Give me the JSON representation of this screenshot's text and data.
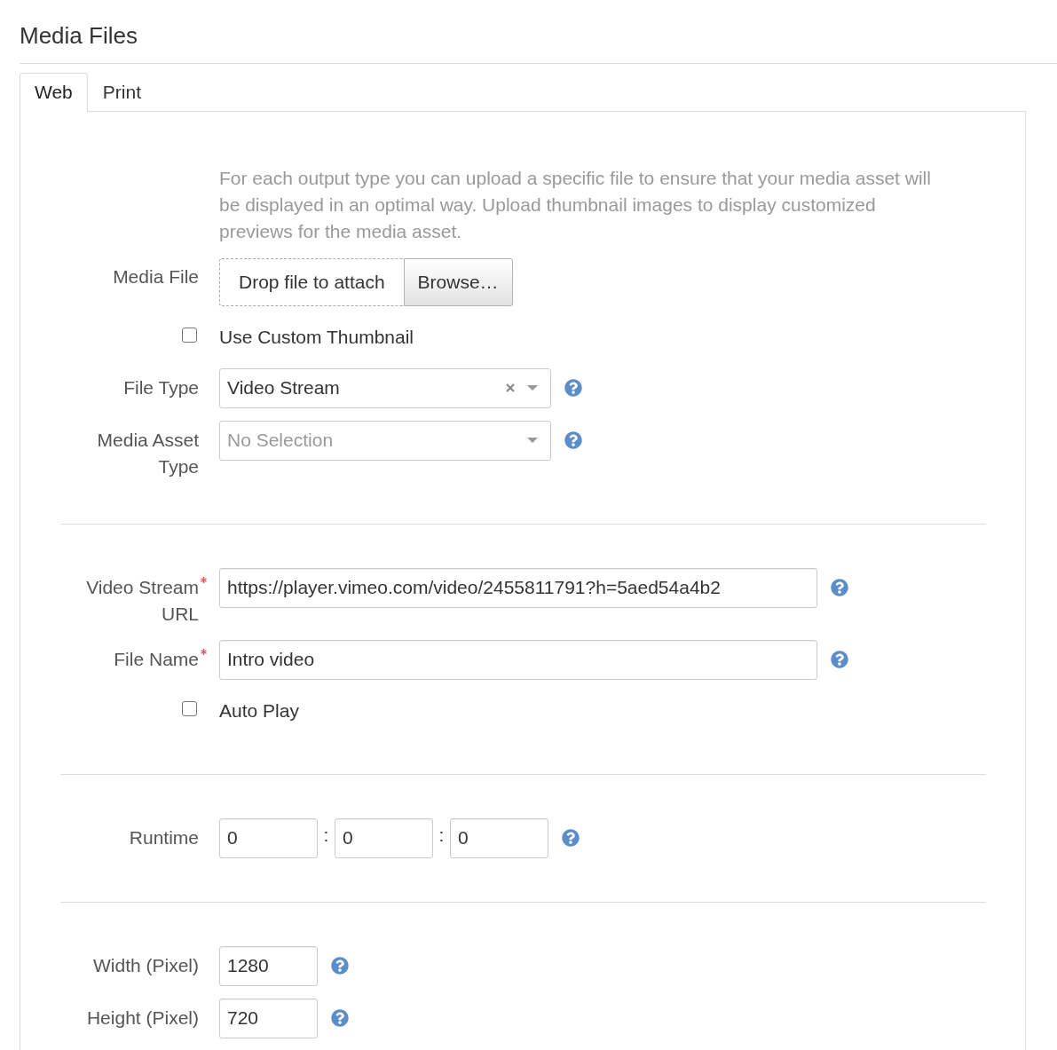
{
  "title": "Media Files",
  "tabs": [
    {
      "label": "Web",
      "selected": true
    },
    {
      "label": "Print",
      "selected": false
    }
  ],
  "description": "For each output type you can upload a specific file to ensure that your media asset will be displayed in an optimal way. Upload thumbnail images to display customized previews for the media asset.",
  "sections": [
    {
      "fields": [
        {
          "kind": "file",
          "label": "Media File",
          "drop_text": "Drop file to attach",
          "button": "Browse…"
        },
        {
          "kind": "checkbox",
          "label": "Use Custom Thumbnail",
          "checked": false
        },
        {
          "kind": "select",
          "label": "File Type",
          "value": "Video Stream",
          "clearable": true,
          "help": true
        },
        {
          "kind": "select",
          "label": "Media Asset Type",
          "placeholder": "No Selection",
          "help": true
        }
      ]
    },
    {
      "fields": [
        {
          "kind": "text",
          "label": "Video Stream URL",
          "required": true,
          "value": "https://player.vimeo.com/video/2455811791?h=5aed54a4b2",
          "help": true
        },
        {
          "kind": "text",
          "label": "File Name",
          "required": true,
          "value": "Intro video",
          "help": true
        },
        {
          "kind": "checkbox",
          "label": "Auto Play",
          "checked": false
        }
      ]
    },
    {
      "fields": [
        {
          "kind": "duration",
          "label": "Runtime",
          "values": [
            "0",
            "0",
            "0"
          ],
          "separators": [
            ":",
            ":"
          ],
          "help": true
        }
      ]
    },
    {
      "fields": [
        {
          "kind": "number",
          "label": "Width (Pixel)",
          "value": "1280",
          "help": true
        },
        {
          "kind": "number",
          "label": "Height (Pixel)",
          "value": "720",
          "help": true
        }
      ]
    }
  ]
}
